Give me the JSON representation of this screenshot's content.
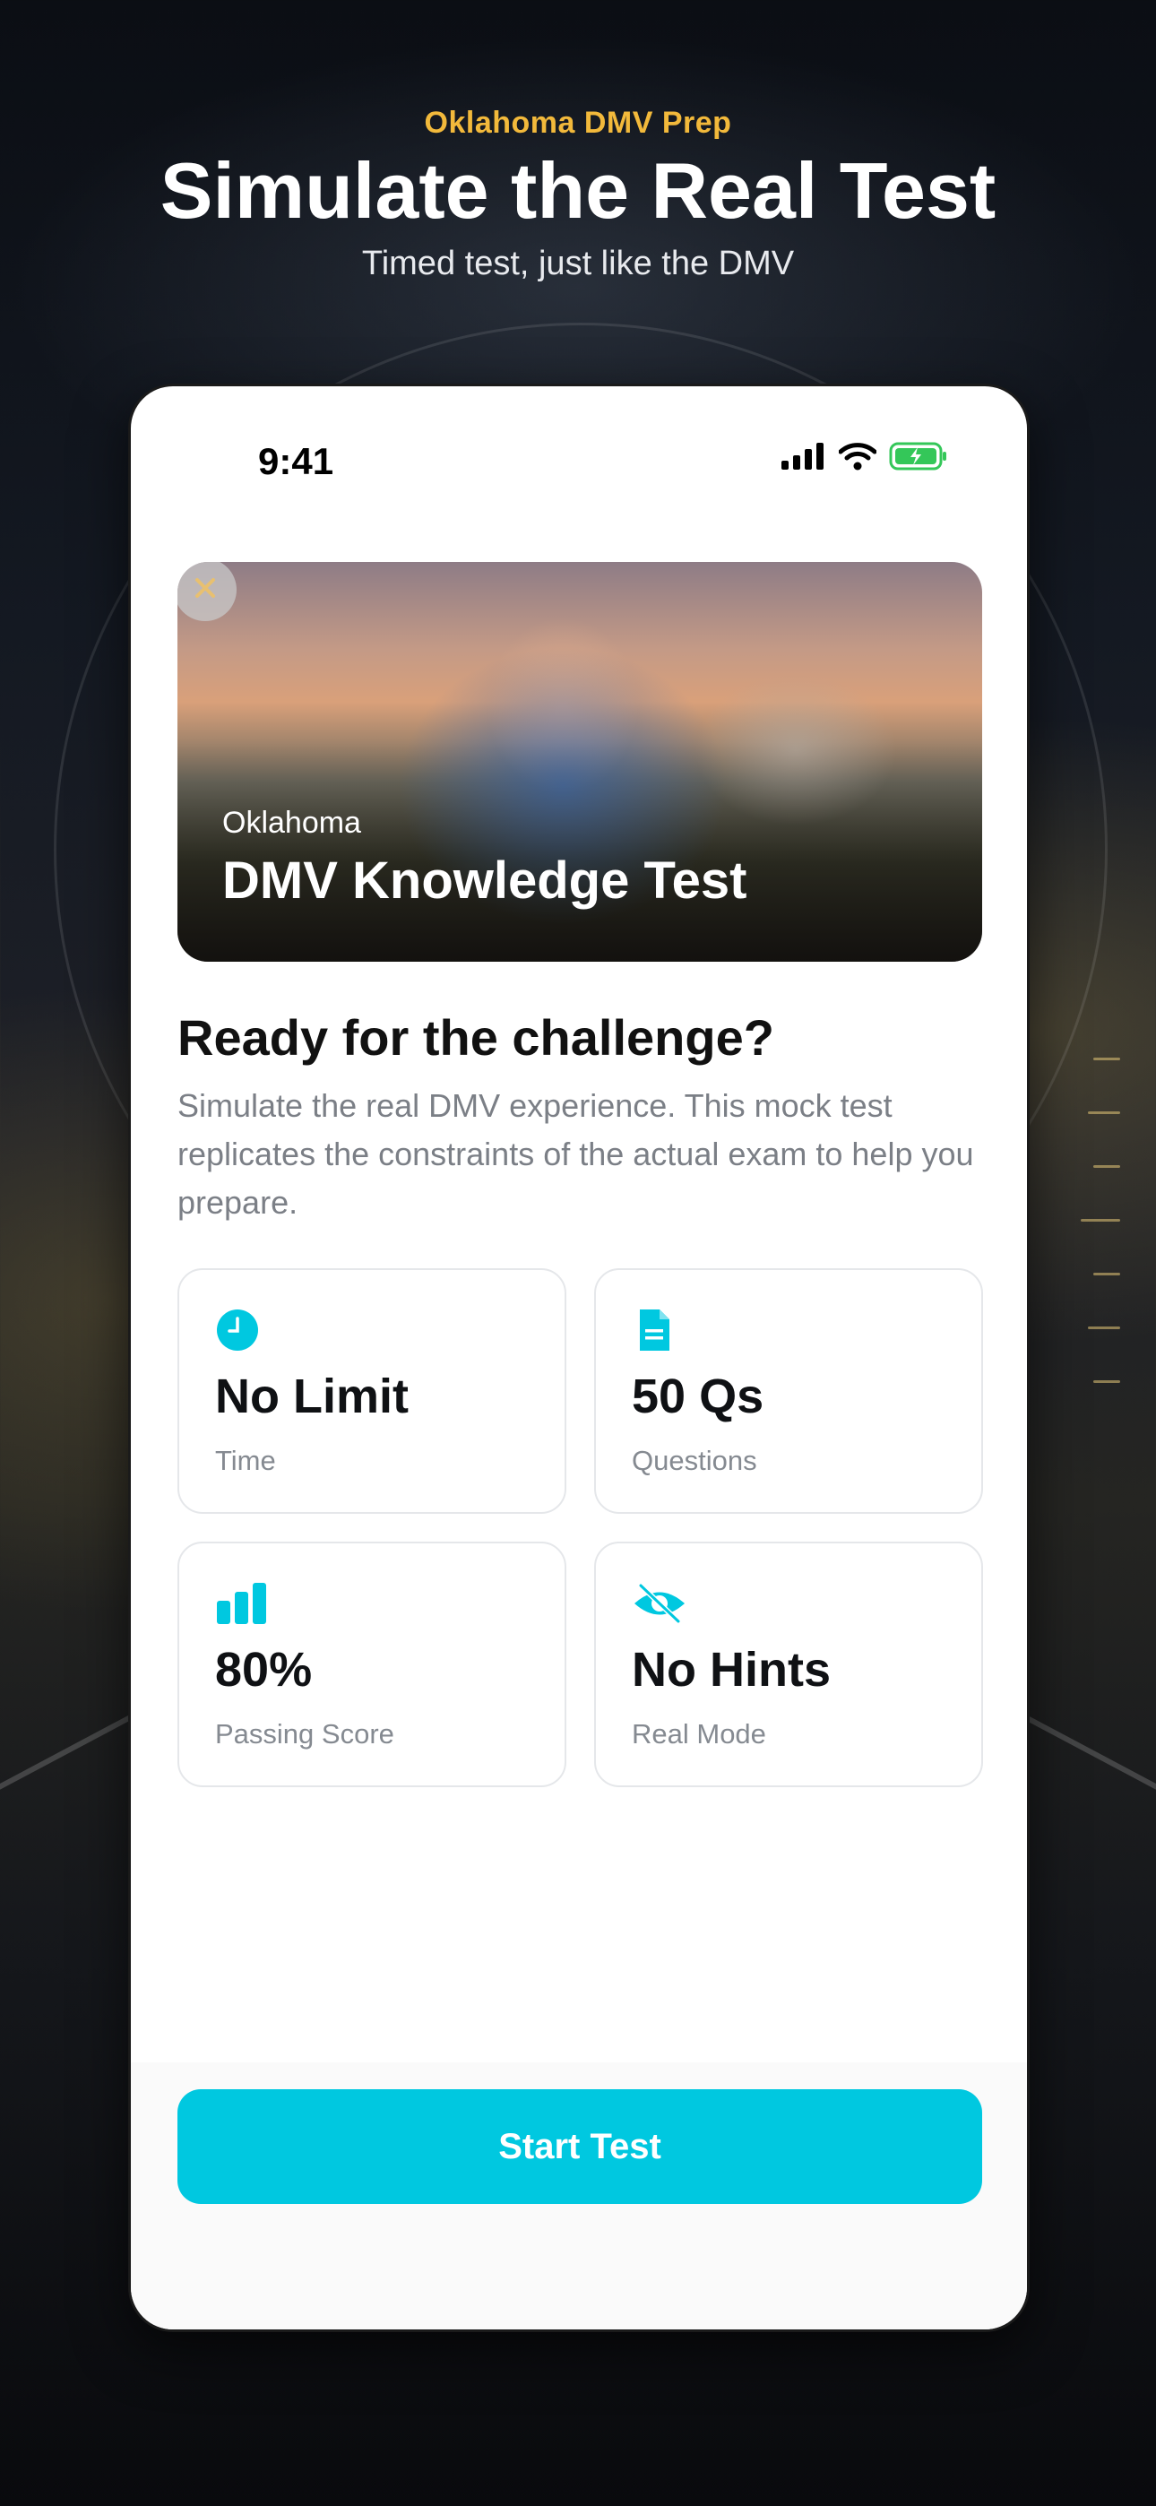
{
  "header": {
    "eyebrow": "Oklahoma DMV Prep",
    "headline": "Simulate the Real Test",
    "subhead": "Timed test, just like the DMV"
  },
  "status_bar": {
    "time": "9:41",
    "icons": [
      "cellular-signal-icon",
      "wifi-icon",
      "battery-charging-icon"
    ]
  },
  "hero": {
    "state": "Oklahoma",
    "title": "DMV Knowledge Test",
    "close_icon": "close-icon"
  },
  "intro": {
    "title": "Ready for the challenge?",
    "description": "Simulate the real DMV experience. This mock test replicates the constraints of the actual exam to help you prepare."
  },
  "stats": [
    {
      "icon": "clock-icon",
      "value": "No Limit",
      "label": "Time"
    },
    {
      "icon": "document-icon",
      "value": "50 Qs",
      "label": "Questions"
    },
    {
      "icon": "bar-chart-icon",
      "value": "80%",
      "label": "Passing Score"
    },
    {
      "icon": "eye-off-icon",
      "value": "No Hints",
      "label": "Real Mode"
    }
  ],
  "cta": {
    "label": "Start Test"
  },
  "colors": {
    "accent": "#00c8e0",
    "eyebrow": "#f2b93b",
    "battery": "#34c759"
  }
}
